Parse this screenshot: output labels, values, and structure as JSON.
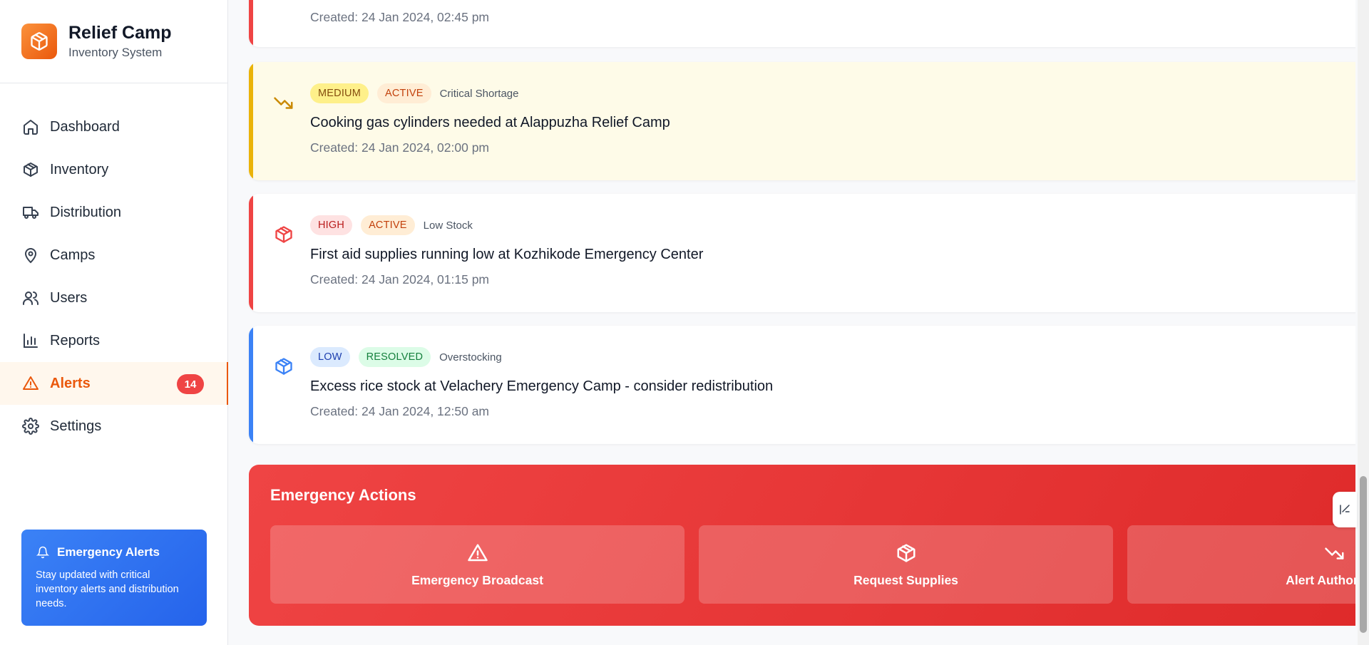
{
  "brand": {
    "title": "Relief Camp",
    "subtitle": "Inventory System",
    "icon": "box-icon",
    "accent": "#ea580c"
  },
  "nav": [
    {
      "label": "Dashboard",
      "icon": "home-icon"
    },
    {
      "label": "Inventory",
      "icon": "box-icon"
    },
    {
      "label": "Distribution",
      "icon": "truck-icon"
    },
    {
      "label": "Camps",
      "icon": "map-pin-icon"
    },
    {
      "label": "Users",
      "icon": "users-icon"
    },
    {
      "label": "Reports",
      "icon": "bar-chart-icon"
    },
    {
      "label": "Alerts",
      "icon": "warning-icon",
      "badge": "14",
      "active": true
    },
    {
      "label": "Settings",
      "icon": "gear-icon"
    }
  ],
  "promo": {
    "title": "Emergency Alerts",
    "text": "Stay updated with critical inventory alerts and distribution needs.",
    "icon": "bell-icon"
  },
  "alerts": [
    {
      "severity": "",
      "status": "",
      "type": "",
      "message": "",
      "created": "Created: 24 Jan 2024, 02:45 pm",
      "color": "#ef4444"
    },
    {
      "severity": "MEDIUM",
      "status": "ACTIVE",
      "type": "Critical Shortage",
      "message": "Cooking gas cylinders needed at Alappuzha Relief Camp",
      "created": "Created: 24 Jan 2024, 02:00 pm",
      "icon": "trending-down-icon",
      "color": "#eab308"
    },
    {
      "severity": "HIGH",
      "status": "ACTIVE",
      "type": "Low Stock",
      "message": "First aid supplies running low at Kozhikode Emergency Center",
      "created": "Created: 24 Jan 2024, 01:15 pm",
      "icon": "box-icon",
      "color": "#ef4444"
    },
    {
      "severity": "LOW",
      "status": "RESOLVED",
      "type": "Overstocking",
      "message": "Excess rice stock at Velachery Emergency Camp - consider redistribution",
      "created": "Created: 24 Jan 2024, 12:50 am",
      "icon": "box-icon",
      "color": "#3b82f6"
    }
  ],
  "emergency": {
    "title": "Emergency Actions",
    "actions": [
      {
        "label": "Emergency Broadcast",
        "icon": "warning-icon"
      },
      {
        "label": "Request Supplies",
        "icon": "box-icon"
      },
      {
        "label": "Alert Authorities",
        "icon": "trending-down-icon"
      }
    ]
  }
}
